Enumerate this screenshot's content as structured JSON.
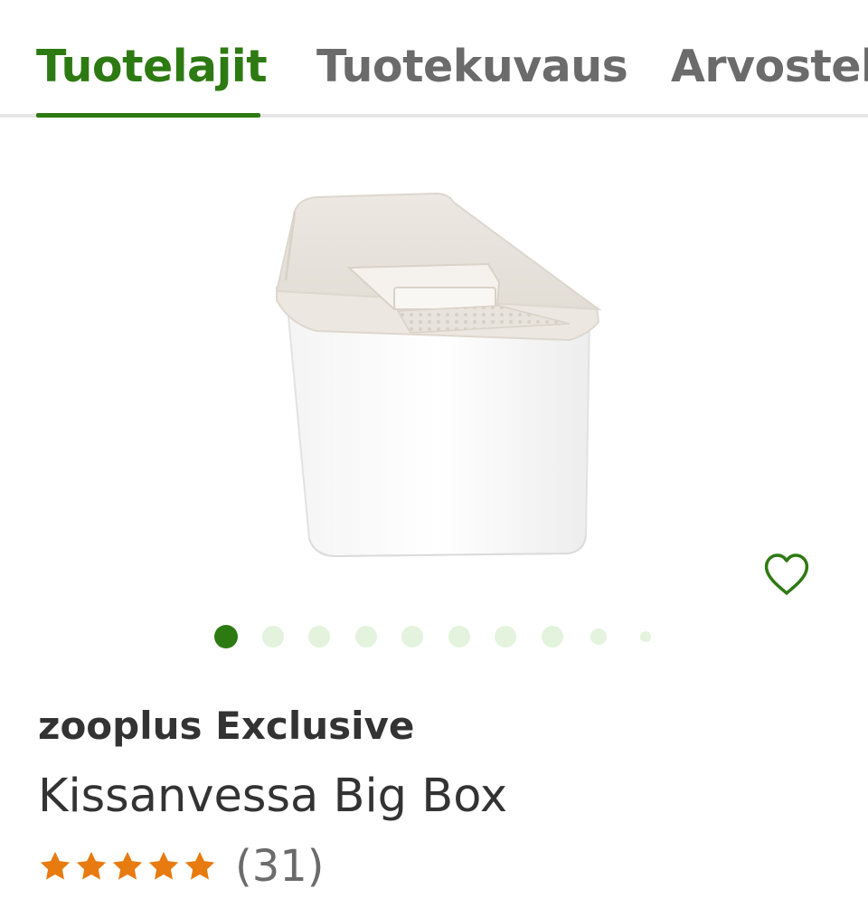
{
  "tabs": [
    {
      "label": "Tuotelajit",
      "active": true
    },
    {
      "label": "Tuotekuvaus",
      "active": false
    },
    {
      "label": "Arvostel",
      "active": false
    }
  ],
  "colors": {
    "accent": "#2d7a12",
    "tab_inactive": "#6b6b6b",
    "star": "#e87b10",
    "dot_inactive": "#e3f3dd"
  },
  "product": {
    "image_icon": "cat-litter-box-image",
    "wishlist_icon": "heart-outline-icon",
    "brand": "zooplus Exclusive",
    "title": "Kissanvessa Big Box",
    "rating": 5,
    "review_count": "(31)"
  },
  "carousel": {
    "total": 10,
    "active_index": 0
  }
}
